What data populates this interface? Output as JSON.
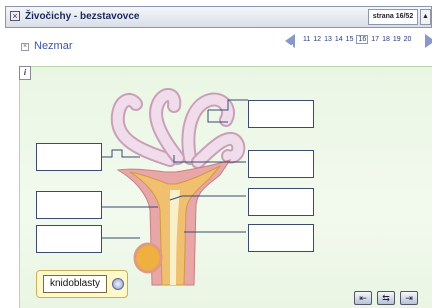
{
  "window": {
    "title": "Živočichy - bezstavovce",
    "page_indicator": "strana 16/52",
    "page_button_glyph": "▲"
  },
  "subheader": {
    "label": "Nezmar"
  },
  "pager": {
    "pages": [
      "11",
      "12",
      "13",
      "14",
      "15",
      "16",
      "17",
      "18",
      "19",
      "20"
    ],
    "current": "16"
  },
  "content": {
    "info_glyph": "i",
    "chip_label": "knidoblasty"
  },
  "toolbar": {
    "buttons": [
      {
        "name": "toolbar-button-1",
        "glyph": "⇤"
      },
      {
        "name": "toolbar-button-2",
        "glyph": "⇆"
      },
      {
        "name": "toolbar-button-3",
        "glyph": "⇥"
      }
    ]
  },
  "colors": {
    "title_text": "#1a2a5a",
    "link": "#3a56a8",
    "body_outer": "#e8a6a6",
    "body_inner": "#f0c070",
    "tentacle": "#e8d0e0",
    "background": "#eaf6e4"
  }
}
